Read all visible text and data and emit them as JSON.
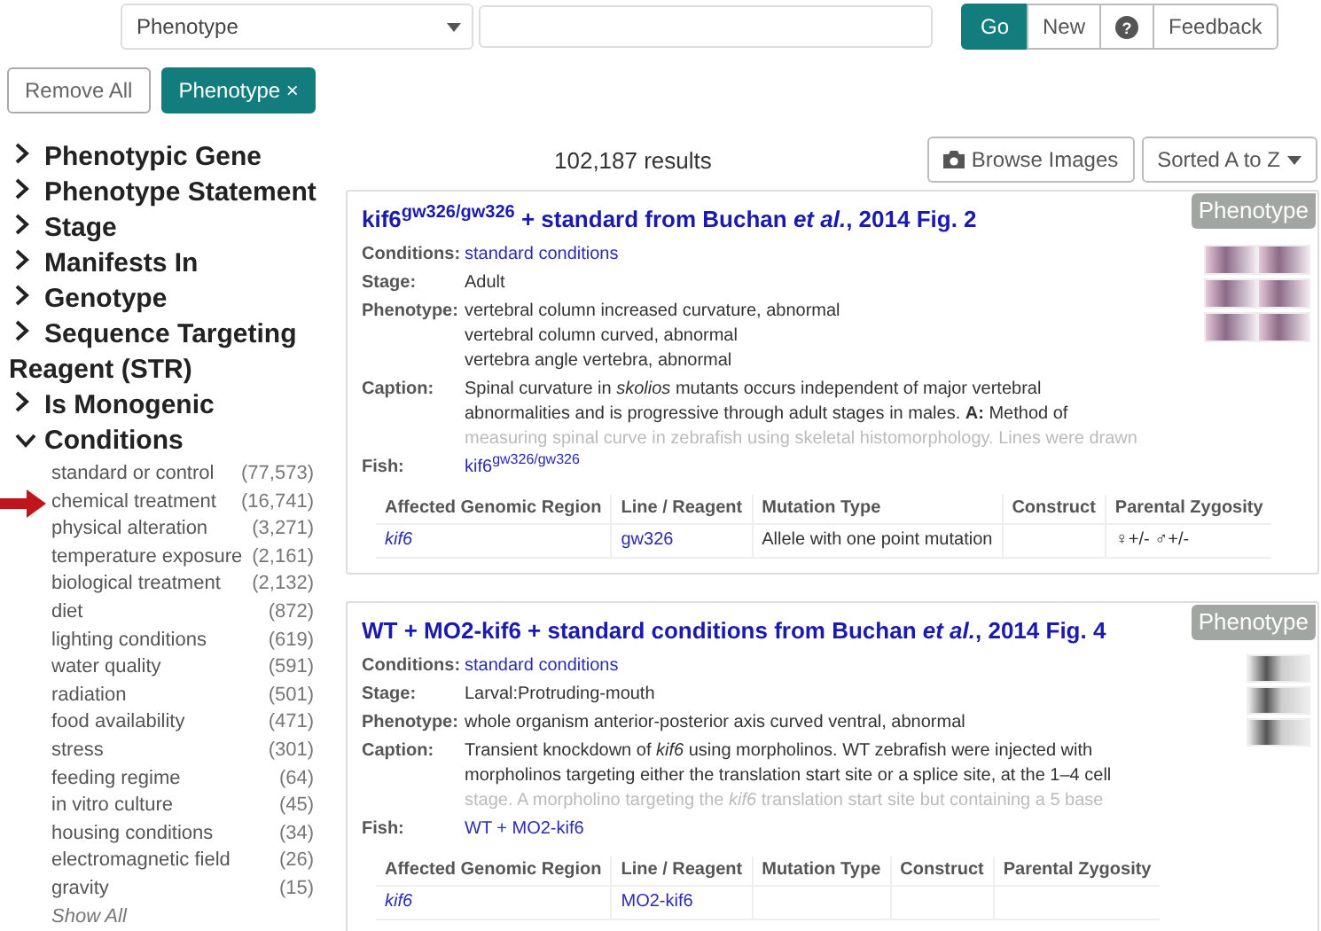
{
  "search": {
    "category": "Phenotype",
    "buttons": [
      {
        "kind": "primary",
        "label": "Go"
      },
      {
        "kind": "default",
        "label": "New"
      },
      {
        "kind": "help",
        "label": "?"
      },
      {
        "kind": "default",
        "label": "Feedback"
      }
    ]
  },
  "filters": {
    "remove_all": "Remove All",
    "chips": [
      {
        "label": "Phenotype ×"
      }
    ]
  },
  "sidebar": {
    "facets": [
      {
        "label": "Phenotypic Gene",
        "expanded": false
      },
      {
        "label": "Phenotype Statement",
        "expanded": false
      },
      {
        "label": "Stage",
        "expanded": false
      },
      {
        "label": "Manifests In",
        "expanded": false
      },
      {
        "label": "Genotype",
        "expanded": false
      },
      {
        "label": "Sequence Targeting Reagent (STR)",
        "expanded": false
      },
      {
        "label": "Is Monogenic",
        "expanded": false
      },
      {
        "label": "Conditions",
        "expanded": true,
        "show_all": "Show All",
        "items": [
          {
            "label": "standard or control",
            "count": "(77,573)",
            "marked": false
          },
          {
            "label": "chemical treatment",
            "count": "(16,741)",
            "marked": true
          },
          {
            "label": "physical alteration",
            "count": "(3,271)",
            "marked": false
          },
          {
            "label": "temperature exposure",
            "count": "(2,161)",
            "marked": false
          },
          {
            "label": "biological treatment",
            "count": "(2,132)",
            "marked": false
          },
          {
            "label": "diet",
            "count": "(872)",
            "marked": false
          },
          {
            "label": "lighting conditions",
            "count": "(619)",
            "marked": false
          },
          {
            "label": "water quality",
            "count": "(591)",
            "marked": false
          },
          {
            "label": "radiation",
            "count": "(501)",
            "marked": false
          },
          {
            "label": "food availability",
            "count": "(471)",
            "marked": false
          },
          {
            "label": "stress",
            "count": "(301)",
            "marked": false
          },
          {
            "label": "feeding regime",
            "count": "(64)",
            "marked": false
          },
          {
            "label": "in vitro culture",
            "count": "(45)",
            "marked": false
          },
          {
            "label": "housing conditions",
            "count": "(34)",
            "marked": false
          },
          {
            "label": "electromagnetic field",
            "count": "(26)",
            "marked": false
          },
          {
            "label": "gravity",
            "count": "(15)",
            "marked": false
          }
        ]
      }
    ]
  },
  "results": {
    "count": "102,187 results",
    "browse_images": "Browse Images",
    "sort": "Sorted A to Z"
  },
  "cards": [
    {
      "title": "kif6$^{gw326/gw326}$ + standard from Buchan *et al.*, 2014 Fig. 2",
      "badge": "Phenotype",
      "figure": {
        "kind": "grid"
      },
      "fields": [
        {
          "label": "Conditions:",
          "kind": "link",
          "lines": [
            "standard conditions"
          ]
        },
        {
          "label": "Stage:",
          "kind": "text",
          "lines": [
            "Adult"
          ]
        },
        {
          "label": "Phenotype:",
          "kind": "text",
          "lines": [
            "vertebral column increased curvature, abnormal",
            "vertebral column curved, abnormal",
            "vertebra angle vertebra, abnormal"
          ]
        },
        {
          "label": "Caption:",
          "kind": "caption",
          "lines": [
            "Spinal curvature in *skolios* mutants occurs independent of major vertebral",
            "abnormalities and is progressive through adult stages in males. **A:** Method of",
            "measuring spinal curve in zebrafish using skeletal histomorphology. Lines were drawn"
          ]
        },
        {
          "label": "Fish:",
          "kind": "link",
          "lines": [
            "kif6$^{gw326/gw326}$"
          ]
        }
      ],
      "table": {
        "columns": [
          "Affected Genomic Region",
          "Line / Reagent",
          "Mutation Type",
          "Construct",
          "Parental Zygosity"
        ],
        "rows": [
          {
            "cells": [
              "kif6",
              "gw326",
              "Allele with one point mutation",
              null,
              "♀+/- ♂+/-"
            ]
          }
        ]
      }
    },
    {
      "title": "WT + MO2-kif6 + standard conditions from Buchan *et al.*, 2014 Fig. 4",
      "badge": "Phenotype",
      "figure": {
        "kind": "stack"
      },
      "fields": [
        {
          "label": "Conditions:",
          "kind": "link",
          "lines": [
            "standard conditions"
          ]
        },
        {
          "label": "Stage:",
          "kind": "text",
          "lines": [
            "Larval:Protruding-mouth"
          ]
        },
        {
          "label": "Phenotype:",
          "kind": "text",
          "lines": [
            "whole organism anterior-posterior axis curved ventral, abnormal"
          ]
        },
        {
          "label": "Caption:",
          "kind": "caption",
          "lines": [
            "Transient knockdown of *kif6* using morpholinos. WT zebrafish were injected with",
            "morpholinos targeting either the translation start site or a splice site, at the 1–4 cell",
            "stage. A morpholino targeting the *kif6* translation start site but containing a 5 base"
          ]
        },
        {
          "label": "Fish:",
          "kind": "link",
          "lines": [
            "WT + MO2-kif6"
          ]
        }
      ],
      "table": {
        "columns": [
          "Affected Genomic Region",
          "Line / Reagent",
          "Mutation Type",
          "Construct",
          "Parental Zygosity"
        ],
        "rows": [
          {
            "cells": [
              "kif6",
              "MO2-kif6",
              null,
              null,
              null
            ]
          }
        ]
      }
    }
  ]
}
